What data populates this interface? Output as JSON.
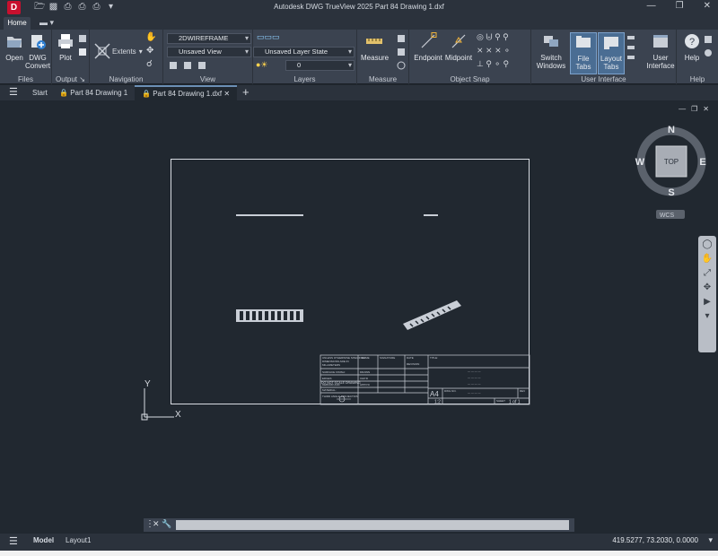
{
  "app": {
    "logo": "D",
    "title": "Autodesk DWG TrueView 2025   Part 84 Drawing 1.dxf"
  },
  "ribbon_tabs": {
    "home": "Home"
  },
  "ribbon": {
    "files": {
      "label": "Files",
      "open": "Open",
      "dwg_convert": "DWG Convert"
    },
    "output": {
      "label": "Output",
      "plot": "Plot"
    },
    "navigation": {
      "label": "Navigation",
      "extents": "Extents"
    },
    "view": {
      "label": "View",
      "visual_style": "2DWIREFRAME",
      "named_view": "Unsaved View"
    },
    "layers": {
      "label": "Layers",
      "layer_state": "Unsaved Layer State",
      "current_layer": "0"
    },
    "measure": {
      "label": "Measure",
      "measure": "Measure"
    },
    "object_snap": {
      "label": "Object Snap",
      "endpoint": "Endpoint",
      "midpoint": "Midpoint"
    },
    "user_interface": {
      "label": "User Interface",
      "switch_windows": "Switch Windows",
      "file_tabs": "File Tabs",
      "layout_tabs": "Layout Tabs",
      "user_interface": "User Interface"
    },
    "help": {
      "label": "Help",
      "help": "Help"
    }
  },
  "doc_tabs": [
    {
      "label": "Start"
    },
    {
      "label": "Part 84 Drawing 1"
    },
    {
      "label": "Part 84 Drawing 1.dxf"
    }
  ],
  "viewcube": {
    "top": "TOP",
    "n": "N",
    "s": "S",
    "e": "E",
    "w": "W",
    "wcs": "WCS"
  },
  "ucs": {
    "x": "X",
    "y": "Y"
  },
  "title_block": {
    "sheet_size": "A4",
    "scale": "1:2",
    "sheet": "1 of 1",
    "dnd": "DO NOT SCALE DRAWING"
  },
  "status": {
    "model_tab": "Model",
    "layout_tab": "Layout1",
    "coords": "419.5277, 73.2030, 0.0000"
  }
}
